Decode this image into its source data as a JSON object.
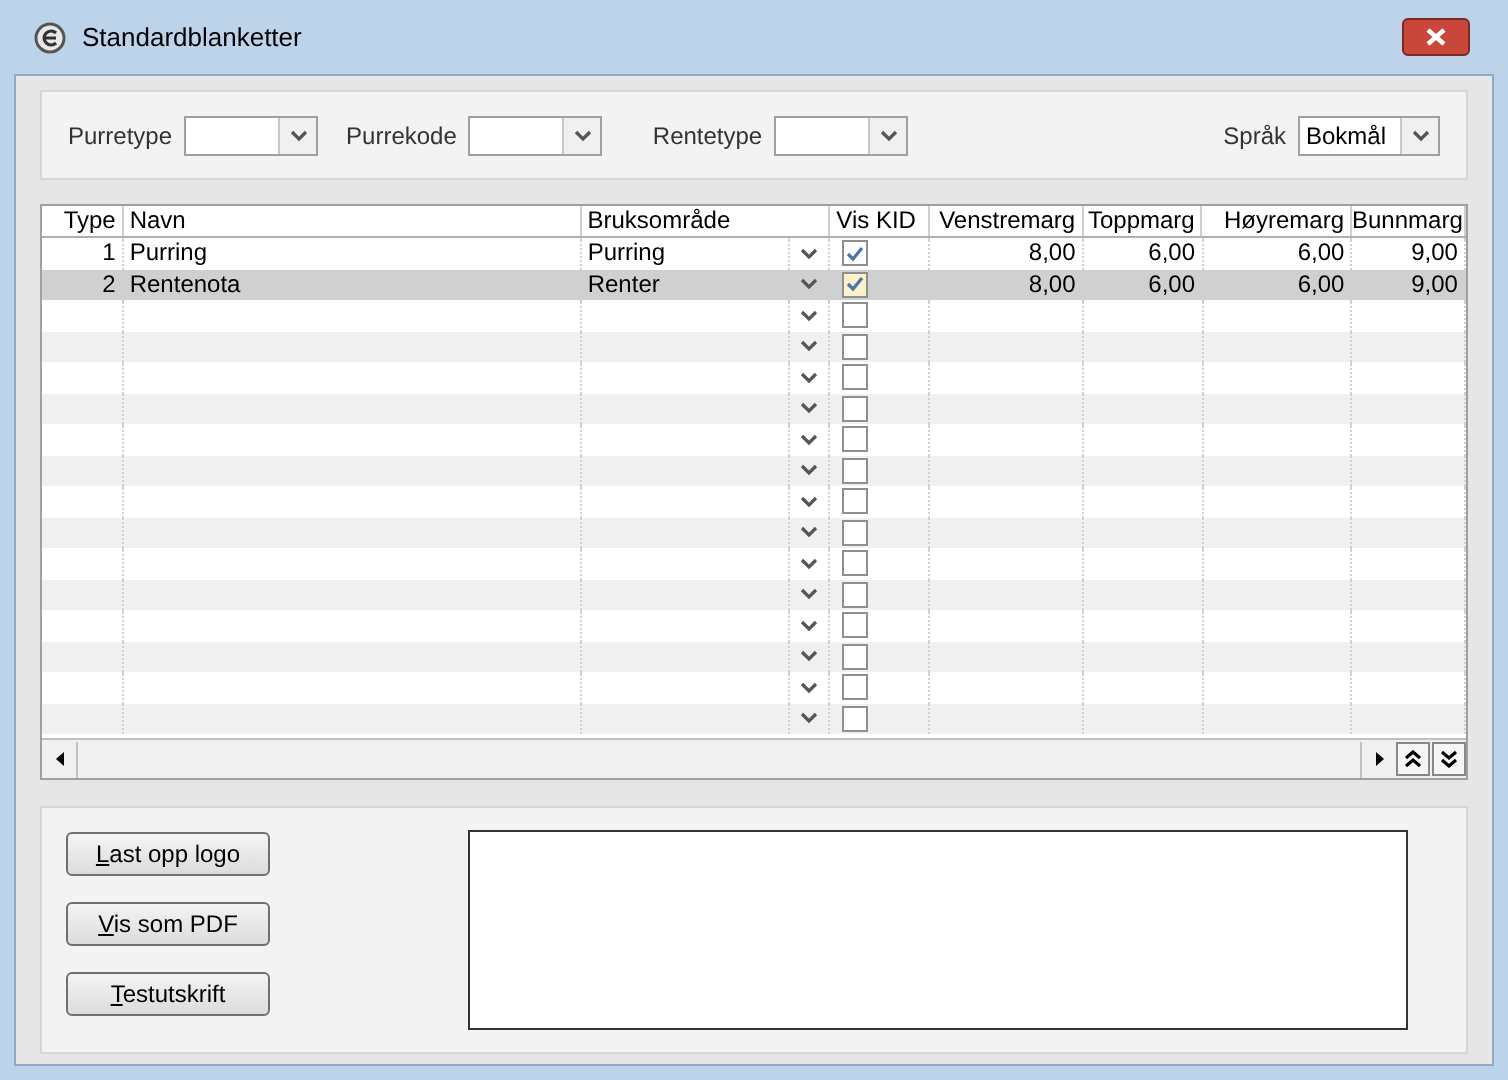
{
  "window": {
    "title": "Standardblanketter"
  },
  "filters": [
    {
      "label": "Purretype"
    },
    {
      "label": "Purrekode"
    },
    {
      "label": "Rentetype"
    },
    {
      "label": "Språk",
      "value": "Bokmål"
    }
  ],
  "table": {
    "columns": [
      "Type",
      "Navn",
      "Bruksområde",
      "Vis KID",
      "Venstremarg",
      "Toppmarg",
      "Høyremarg",
      "Bunnmarg"
    ],
    "rows": [
      {
        "type": "1",
        "navn": "Purring",
        "bruksomrade": "Purring",
        "vis_kid": true,
        "venstremarg": "8,00",
        "toppmarg": "6,00",
        "hoyremarg": "6,00",
        "bunnmarg": "9,00",
        "selected": false
      },
      {
        "type": "2",
        "navn": "Rentenota",
        "bruksomrade": "Renter",
        "vis_kid": true,
        "venstremarg": "8,00",
        "toppmarg": "6,00",
        "hoyremarg": "6,00",
        "bunnmarg": "9,00",
        "selected": true
      },
      {
        "vis_kid": false,
        "selected": false
      },
      {
        "vis_kid": false,
        "selected": false
      },
      {
        "vis_kid": false,
        "selected": false
      },
      {
        "vis_kid": false,
        "selected": false
      },
      {
        "vis_kid": false,
        "selected": false
      },
      {
        "vis_kid": false,
        "selected": false
      },
      {
        "vis_kid": false,
        "selected": false
      },
      {
        "vis_kid": false,
        "selected": false
      },
      {
        "vis_kid": false,
        "selected": false
      },
      {
        "vis_kid": false,
        "selected": false
      },
      {
        "vis_kid": false,
        "selected": false
      },
      {
        "vis_kid": false,
        "selected": false
      },
      {
        "vis_kid": false,
        "selected": false
      },
      {
        "vis_kid": false,
        "selected": false
      }
    ]
  },
  "buttons": [
    {
      "label": "Last opp logo"
    },
    {
      "label": "Vis som PDF"
    },
    {
      "label": "Testutskrift"
    }
  ]
}
